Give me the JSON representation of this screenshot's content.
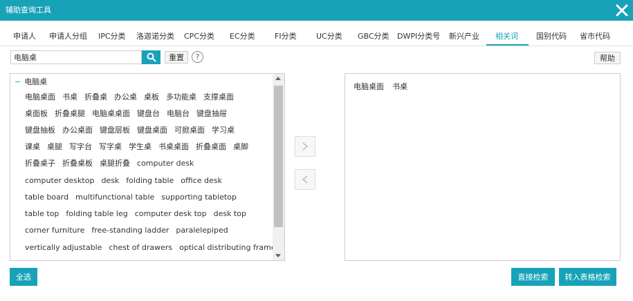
{
  "window": {
    "title": "辅助查询工具",
    "accent_color": "#17a2b8"
  },
  "tabs": [
    {
      "label": "申请人"
    },
    {
      "label": "申请人分组"
    },
    {
      "label": "IPC分类"
    },
    {
      "label": "洛迦诺分类"
    },
    {
      "label": "CPC分类"
    },
    {
      "label": "EC分类"
    },
    {
      "label": "FI分类"
    },
    {
      "label": "UC分类"
    },
    {
      "label": "GBC分类"
    },
    {
      "label": "DWPI分类号"
    },
    {
      "label": "新兴产业"
    },
    {
      "label": "相关词",
      "active": true
    },
    {
      "label": "国别代码"
    },
    {
      "label": "省市代码"
    }
  ],
  "search": {
    "value": "电脑桌",
    "button_icon": "search-icon",
    "reset_label": "重置",
    "help_symbol": "?"
  },
  "help_label": "帮助",
  "tree": {
    "root_label": "电脑桌",
    "toggle_symbol": "−",
    "rows": [
      [
        "电脑桌面",
        "书桌",
        "折叠桌",
        "办公桌",
        "桌板",
        "多功能桌",
        "支撑桌面"
      ],
      [
        "桌面板",
        "折叠桌腿",
        "电脑桌桌面",
        "键盘台",
        "电脑台",
        "键盘抽屉"
      ],
      [
        "键盘抽板",
        "办公桌面",
        "键盘层板",
        "键盘桌面",
        "可掀桌面",
        "学习桌"
      ],
      [
        "课桌",
        "桌腿",
        "写字台",
        "写字桌",
        "学生桌",
        "书桌桌面",
        "折叠桌面",
        "桌脚"
      ],
      [
        "折叠桌子",
        "折叠桌板",
        "桌腿折叠",
        "computer desk"
      ],
      [
        "computer desktop",
        "desk",
        "folding table",
        "office desk"
      ],
      [
        "table board",
        "multifunctional table",
        "supporting tabletop"
      ],
      [
        "table top",
        "folding table leg",
        "computer desk top",
        "desk top"
      ],
      [
        "corner furniture",
        "free-standing ladder",
        "paralelepiped"
      ],
      [
        "vertically adjustable",
        "chest of drawers",
        "optical distributing frame"
      ]
    ]
  },
  "selected": [
    "电脑桌面",
    "书桌"
  ],
  "footer": {
    "select_all_label": "全选",
    "direct_search_label": "直接检索",
    "table_search_label": "转入表格检索"
  }
}
